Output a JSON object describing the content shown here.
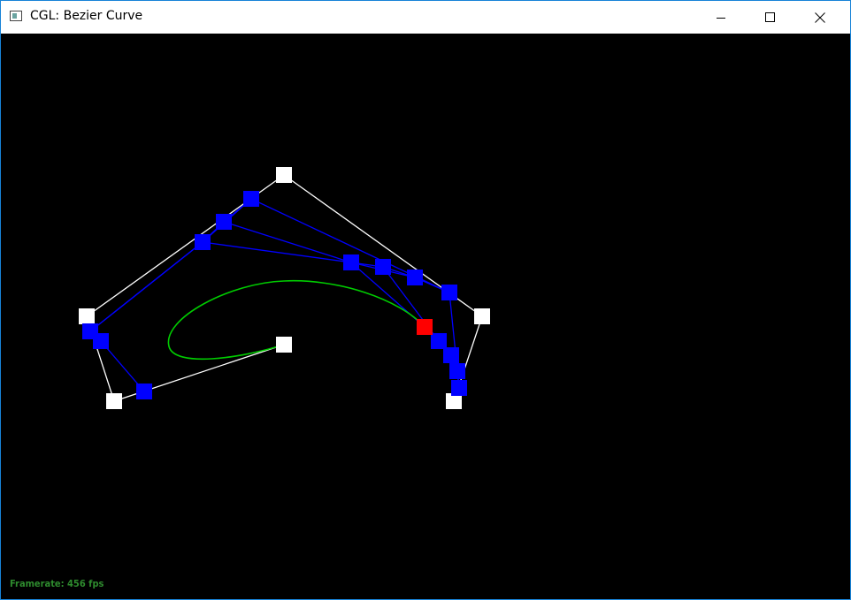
{
  "window": {
    "title": "CGL: Bezier Curve",
    "controls": {
      "minimize_icon": "minimize-icon",
      "maximize_icon": "maximize-icon",
      "close_icon": "close-icon"
    }
  },
  "canvas": {
    "background": "#000000",
    "framerate_text": "Framerate: 456 fps",
    "colors": {
      "control_point": "#ffffff",
      "control_polygon": "#ffffff",
      "intermediate_point": "#0000ff",
      "intermediate_line": "#0000ff",
      "evaluated_point": "#ff0000",
      "curve": "#00cc00",
      "framerate": "#2e8b2e"
    }
  }
}
